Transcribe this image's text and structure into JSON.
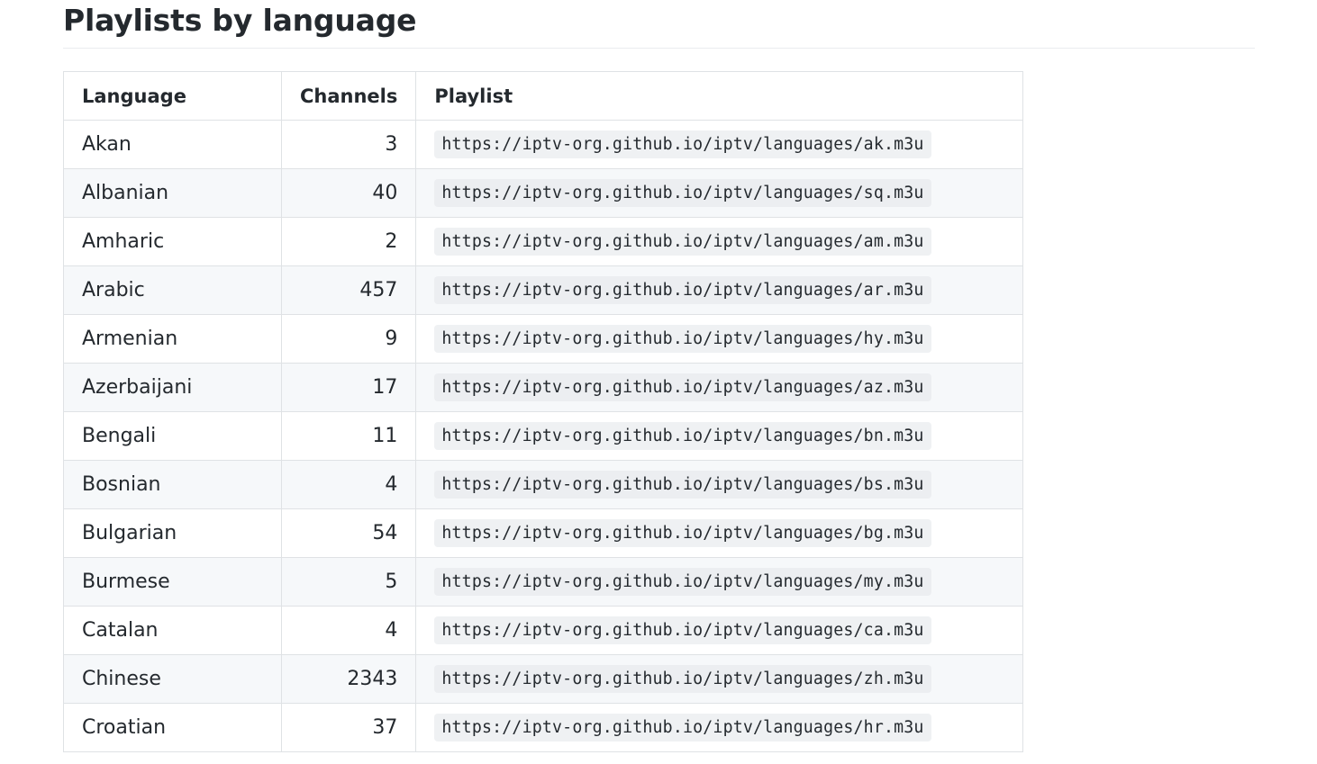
{
  "section": {
    "title": "Playlists by language"
  },
  "table": {
    "headers": {
      "language": "Language",
      "channels": "Channels",
      "playlist": "Playlist"
    },
    "rows": [
      {
        "language": "Akan",
        "channels": "3",
        "playlist": "https://iptv-org.github.io/iptv/languages/ak.m3u"
      },
      {
        "language": "Albanian",
        "channels": "40",
        "playlist": "https://iptv-org.github.io/iptv/languages/sq.m3u"
      },
      {
        "language": "Amharic",
        "channels": "2",
        "playlist": "https://iptv-org.github.io/iptv/languages/am.m3u"
      },
      {
        "language": "Arabic",
        "channels": "457",
        "playlist": "https://iptv-org.github.io/iptv/languages/ar.m3u"
      },
      {
        "language": "Armenian",
        "channels": "9",
        "playlist": "https://iptv-org.github.io/iptv/languages/hy.m3u"
      },
      {
        "language": "Azerbaijani",
        "channels": "17",
        "playlist": "https://iptv-org.github.io/iptv/languages/az.m3u"
      },
      {
        "language": "Bengali",
        "channels": "11",
        "playlist": "https://iptv-org.github.io/iptv/languages/bn.m3u"
      },
      {
        "language": "Bosnian",
        "channels": "4",
        "playlist": "https://iptv-org.github.io/iptv/languages/bs.m3u"
      },
      {
        "language": "Bulgarian",
        "channels": "54",
        "playlist": "https://iptv-org.github.io/iptv/languages/bg.m3u"
      },
      {
        "language": "Burmese",
        "channels": "5",
        "playlist": "https://iptv-org.github.io/iptv/languages/my.m3u"
      },
      {
        "language": "Catalan",
        "channels": "4",
        "playlist": "https://iptv-org.github.io/iptv/languages/ca.m3u"
      },
      {
        "language": "Chinese",
        "channels": "2343",
        "playlist": "https://iptv-org.github.io/iptv/languages/zh.m3u"
      },
      {
        "language": "Croatian",
        "channels": "37",
        "playlist": "https://iptv-org.github.io/iptv/languages/hr.m3u"
      }
    ]
  }
}
